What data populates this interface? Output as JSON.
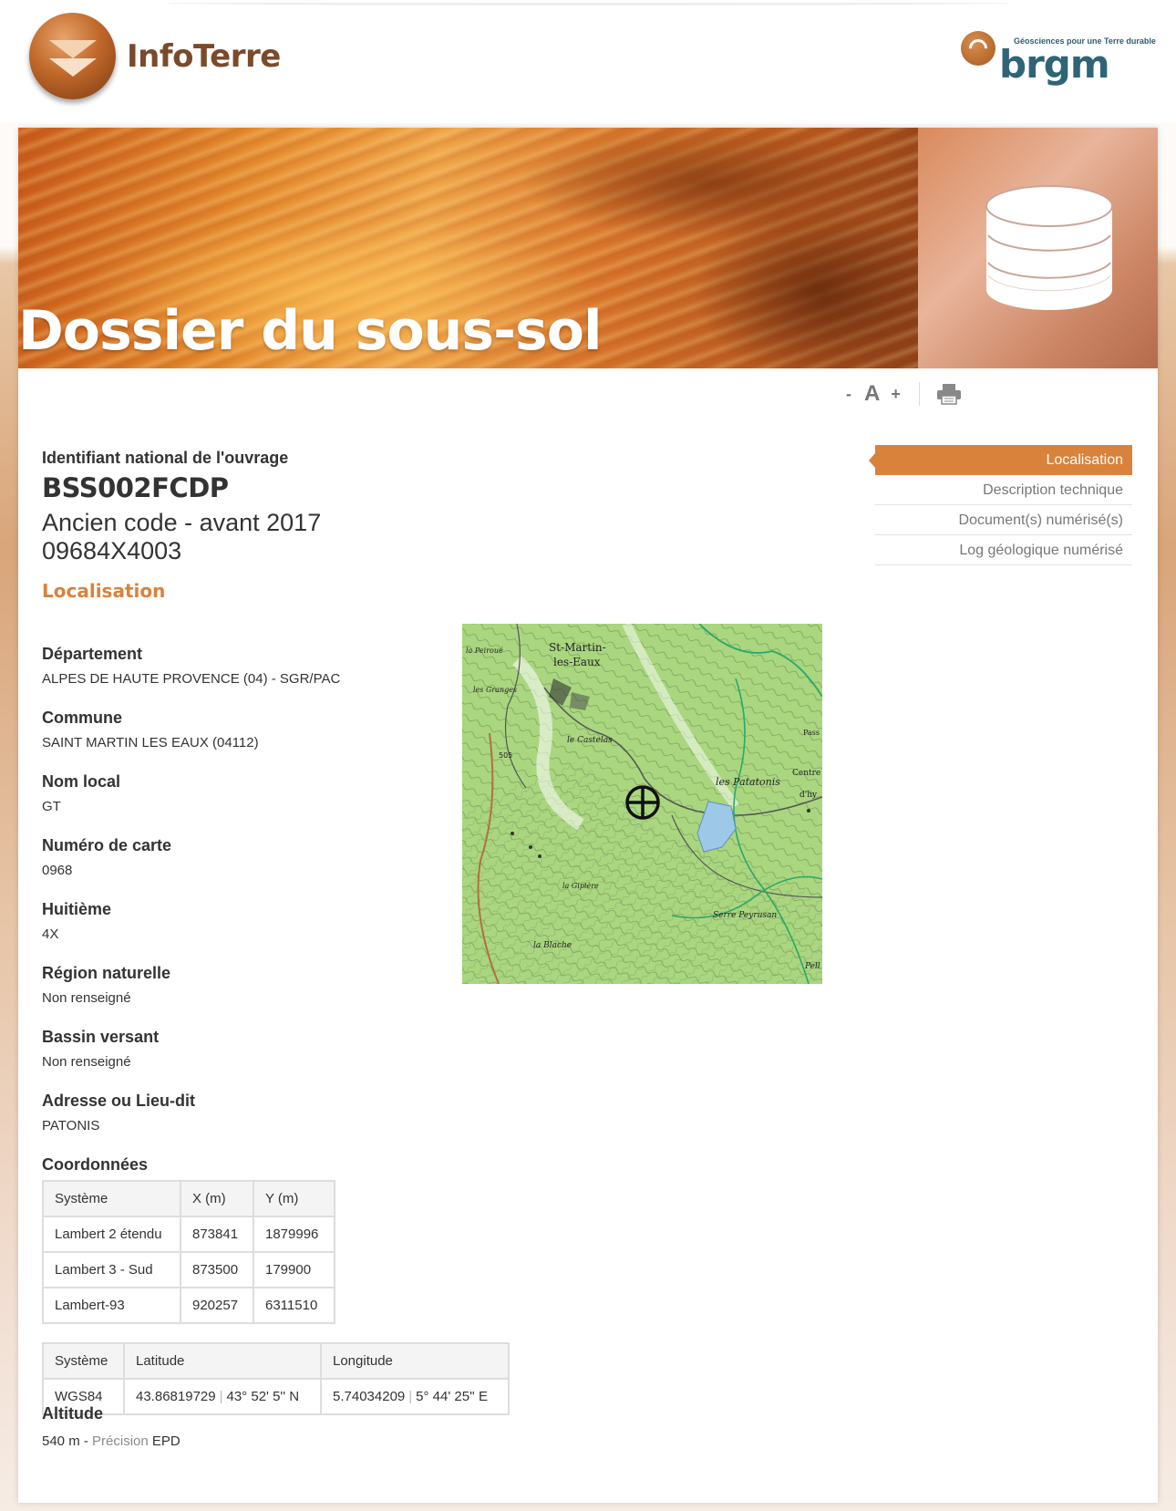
{
  "header": {
    "app_name": "InfoTerre",
    "partner_name": "brgm",
    "partner_tagline": "Géosciences pour une Terre durable"
  },
  "banner": {
    "title": "Dossier du sous-sol"
  },
  "toolbar": {
    "decrease": "-",
    "font": "A",
    "increase": "+"
  },
  "ouvrage": {
    "id_label": "Identifiant national de l'ouvrage",
    "id_value": "BSS002FCDP",
    "old_code_label": "Ancien code - avant 2017",
    "old_code_value": "09684X4003"
  },
  "section_heading": "Localisation",
  "sidenav": [
    {
      "label": "Localisation",
      "active": true
    },
    {
      "label": "Description technique",
      "active": false
    },
    {
      "label": "Document(s) numérisé(s)",
      "active": false
    },
    {
      "label": "Log géologique numérisé",
      "active": false
    }
  ],
  "fields": [
    {
      "label": "Département",
      "value": "ALPES DE HAUTE PROVENCE (04) - SGR/PAC"
    },
    {
      "label": "Commune",
      "value": "SAINT MARTIN LES EAUX (04112)"
    },
    {
      "label": "Nom local",
      "value": "GT"
    },
    {
      "label": "Numéro de carte",
      "value": "0968"
    },
    {
      "label": "Huitième",
      "value": "4X"
    },
    {
      "label": "Région naturelle",
      "value": "Non renseigné"
    },
    {
      "label": "Bassin versant",
      "value": "Non renseigné"
    },
    {
      "label": "Adresse ou Lieu-dit",
      "value": "PATONIS"
    },
    {
      "label": "Coordonnées",
      "value": ""
    }
  ],
  "map": {
    "labels": {
      "st_martin": "St-Martin-",
      "les_eaux": "les-Eaux",
      "peiroue": "la Peiroué",
      "granges": "les Granges",
      "castelas": "le Castelas",
      "patatonis": "les Patatonis",
      "gipiere": "la Gipière",
      "blache": "la Blache",
      "serre": "Serre Peyrusan",
      "pass": "Pass",
      "centre": "Centre",
      "dhy": "d'hy",
      "pell": "Pell",
      "n505": "505"
    }
  },
  "coords_table": {
    "headers": [
      "Système",
      "X (m)",
      "Y (m)"
    ],
    "rows": [
      [
        "Lambert 2 étendu",
        "873841",
        "1879996"
      ],
      [
        "Lambert 3 - Sud",
        "873500",
        "179900"
      ],
      [
        "Lambert-93",
        "920257",
        "6311510"
      ]
    ]
  },
  "wgs_table": {
    "headers": [
      "Système",
      "Latitude",
      "Longitude"
    ],
    "row": {
      "system": "WGS84",
      "lat_dec": "43.86819729",
      "lat_dms": "43° 52' 5'' N",
      "lon_dec": "5.74034209",
      "lon_dms": "5° 44' 25'' E"
    }
  },
  "altitude": {
    "label": "Altitude",
    "value": "540 m",
    "sep": " - ",
    "precision_label": "Précision",
    "precision_value": "EPD"
  }
}
